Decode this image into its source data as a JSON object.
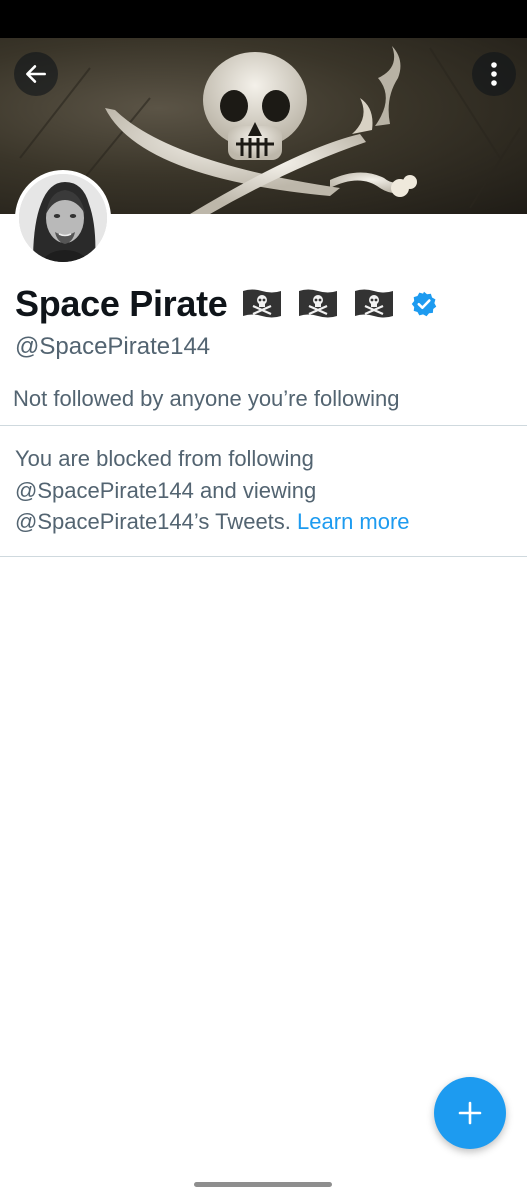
{
  "profile": {
    "display_name": "Space Pirate",
    "name_emojis": [
      "pirate-flag",
      "pirate-flag",
      "pirate-flag"
    ],
    "verified": true,
    "handle": "@SpacePirate144",
    "followers_note": "Not followed by anyone you’re following"
  },
  "blocked_notice": {
    "line1": "You are blocked from following",
    "line2": "@SpacePirate144 and viewing",
    "line3": "@SpacePirate144’s Tweets.",
    "link_text": "Learn more"
  },
  "icons": {
    "back": "arrow-left-icon",
    "more": "more-vertical-icon",
    "compose": "plus-icon",
    "verified": "verified-badge-icon"
  },
  "colors": {
    "accent": "#1d9bf0",
    "text_primary": "#0f1419",
    "text_secondary": "#536471",
    "divider": "#cfd9de"
  }
}
